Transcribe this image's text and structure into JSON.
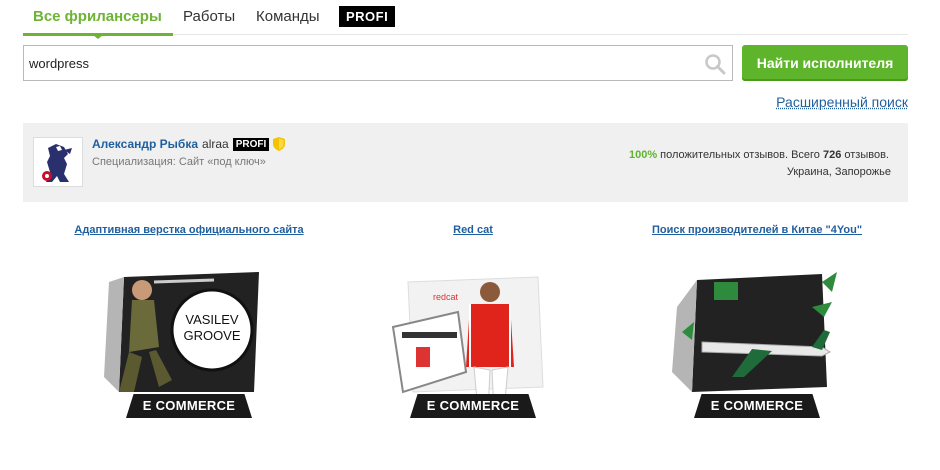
{
  "tabs": {
    "all_freelancers": "Все фрилансеры",
    "works": "Работы",
    "teams": "Команды",
    "profi": "PROFI"
  },
  "search": {
    "value": "wordpress",
    "placeholder": "",
    "button_label": "Найти исполнителя",
    "advanced_label": "Расширенный поиск"
  },
  "freelancer": {
    "name": "Александр Рыбка",
    "login": "alraa",
    "badge": "PROFI",
    "specialization": "Специализация: Сайт «под ключ»",
    "reviews_pct": "100%",
    "reviews_text_1": " положительных отзывов. Всего ",
    "reviews_count": "726",
    "reviews_text_2": " отзывов.",
    "location": "Украина, Запорожье"
  },
  "portfolio": [
    {
      "title": "Адаптивная верстка официального сайта",
      "banner": "E COMMERCE"
    },
    {
      "title": "Red cat",
      "banner": "E COMMERCE"
    },
    {
      "title": "Поиск производителей в Китае \"4You\"",
      "banner": "E COMMERCE"
    }
  ],
  "colors": {
    "accent_green": "#5eb52c",
    "link_blue": "#1f5f9f",
    "card_bg": "#f0f0f0"
  }
}
